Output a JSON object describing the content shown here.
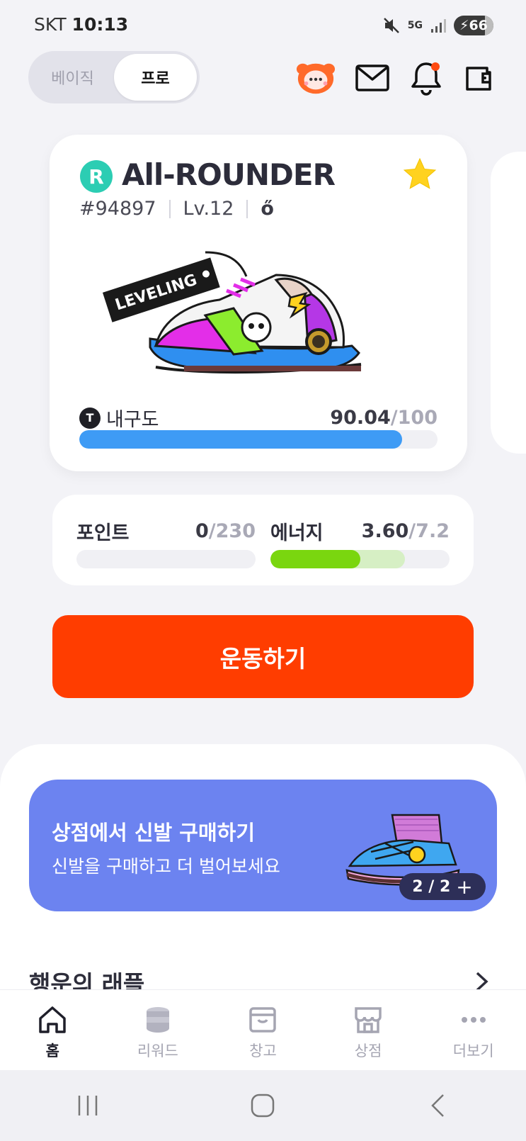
{
  "status_bar": {
    "carrier": "SKT",
    "time": "10:13",
    "network": "5G",
    "battery": "66"
  },
  "mode_toggle": {
    "options": [
      "베이직",
      "프로"
    ],
    "selected": "프로"
  },
  "header_icons": [
    "mascot-icon",
    "mail-icon",
    "bell-icon",
    "wallet-icon"
  ],
  "shoe": {
    "rarity": "R",
    "name": "All-ROUNDER",
    "id": "#94897",
    "level": "Lv.12",
    "type_glyph": "ő",
    "tag_text": "LEVELING",
    "durability_label": "내구도",
    "durability_value": "90.04",
    "durability_max": "/100",
    "durability_fraction": 0.9004
  },
  "stats": {
    "points": {
      "label": "포인트",
      "value": "0",
      "max": "/230",
      "fraction": 0
    },
    "energy": {
      "label": "에너지",
      "value": "3.60",
      "max": "/7.2",
      "fraction": 0.5,
      "secondary_fraction": 0.75
    }
  },
  "exercise_button": "운동하기",
  "banner": {
    "title": "상점에서 신발 구매하기",
    "subtitle": "신발을 구매하고 더 벌어보세요",
    "pager": "2 / 2"
  },
  "section": {
    "title": "행운의 래플"
  },
  "bottom_nav": [
    {
      "label": "홈",
      "icon": "home-icon",
      "active": true
    },
    {
      "label": "리워드",
      "icon": "coins-icon",
      "active": false
    },
    {
      "label": "창고",
      "icon": "box-icon",
      "active": false
    },
    {
      "label": "상점",
      "icon": "store-icon",
      "active": false
    },
    {
      "label": "더보기",
      "icon": "more-icon",
      "active": false
    }
  ],
  "colors": {
    "accent": "#ff3d00",
    "durability": "#3e9bf5",
    "energy": "#7ad60f",
    "banner": "#6c83f0",
    "rarity": "#2ccdb3"
  }
}
